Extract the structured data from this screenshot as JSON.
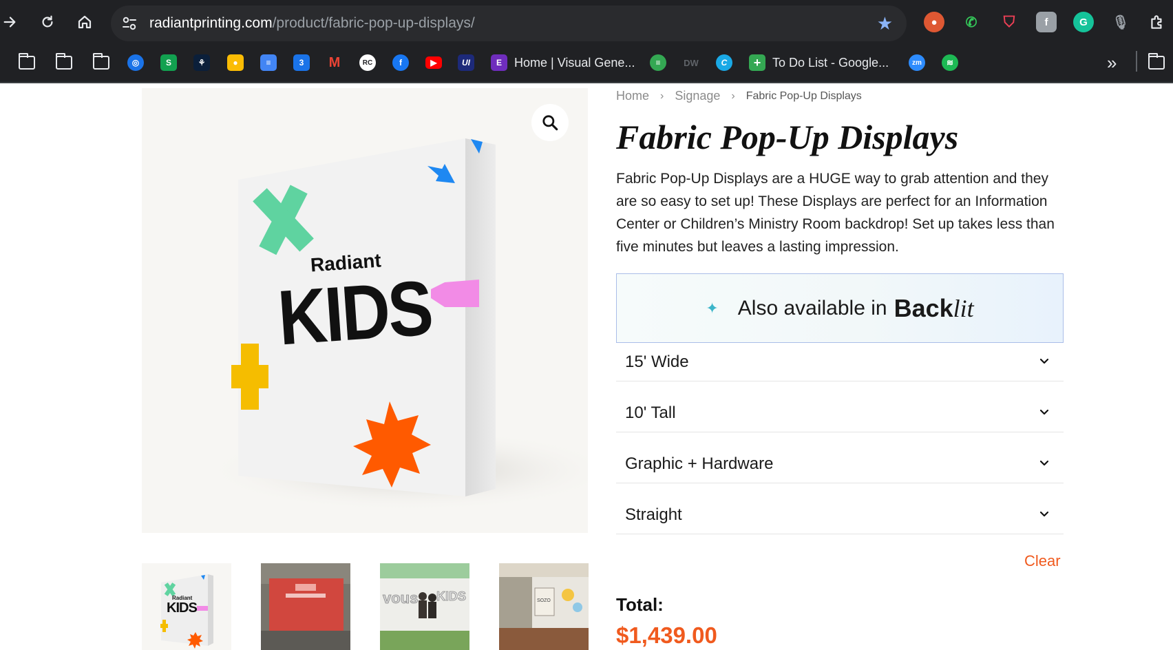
{
  "browser": {
    "url_domain": "radiantprinting.com",
    "url_path": "/product/fabric-pop-up-displays/",
    "bookmarks": [
      {
        "label": "Home | Visual Gene..."
      },
      {
        "label": "To Do List - Google..."
      }
    ],
    "overflow_label": "»"
  },
  "hero_image": {
    "brand_small": "Radiant",
    "brand_big": "KIDS"
  },
  "thumbnails": {
    "first_brand_small": "Radiant",
    "first_brand_big": "KIDS"
  },
  "breadcrumb": {
    "home": "Home",
    "category": "Signage",
    "current": "Fabric Pop-Up Displays"
  },
  "product": {
    "title": "Fabric Pop-Up Displays",
    "description": "Fabric Pop-Up Displays are a HUGE way to grab attention and they are so easy to set up! These Displays are perfect for an Information Center or Children’s Ministry Room backdrop! Set up takes less than five minutes but leaves a lasting impression."
  },
  "backlit_banner": {
    "text": "Also available in",
    "brand_a": "Back",
    "brand_b": "lit"
  },
  "options": [
    {
      "value": "15' Wide"
    },
    {
      "value": "10' Tall"
    },
    {
      "value": "Graphic + Hardware"
    },
    {
      "value": "Straight"
    }
  ],
  "clear_label": "Clear",
  "total": {
    "label": "Total:",
    "value": "$1,439.00"
  },
  "colors": {
    "accent_orange": "#f05a1e",
    "chrome_bg": "#202124",
    "star_blue": "#8ab4f8"
  }
}
